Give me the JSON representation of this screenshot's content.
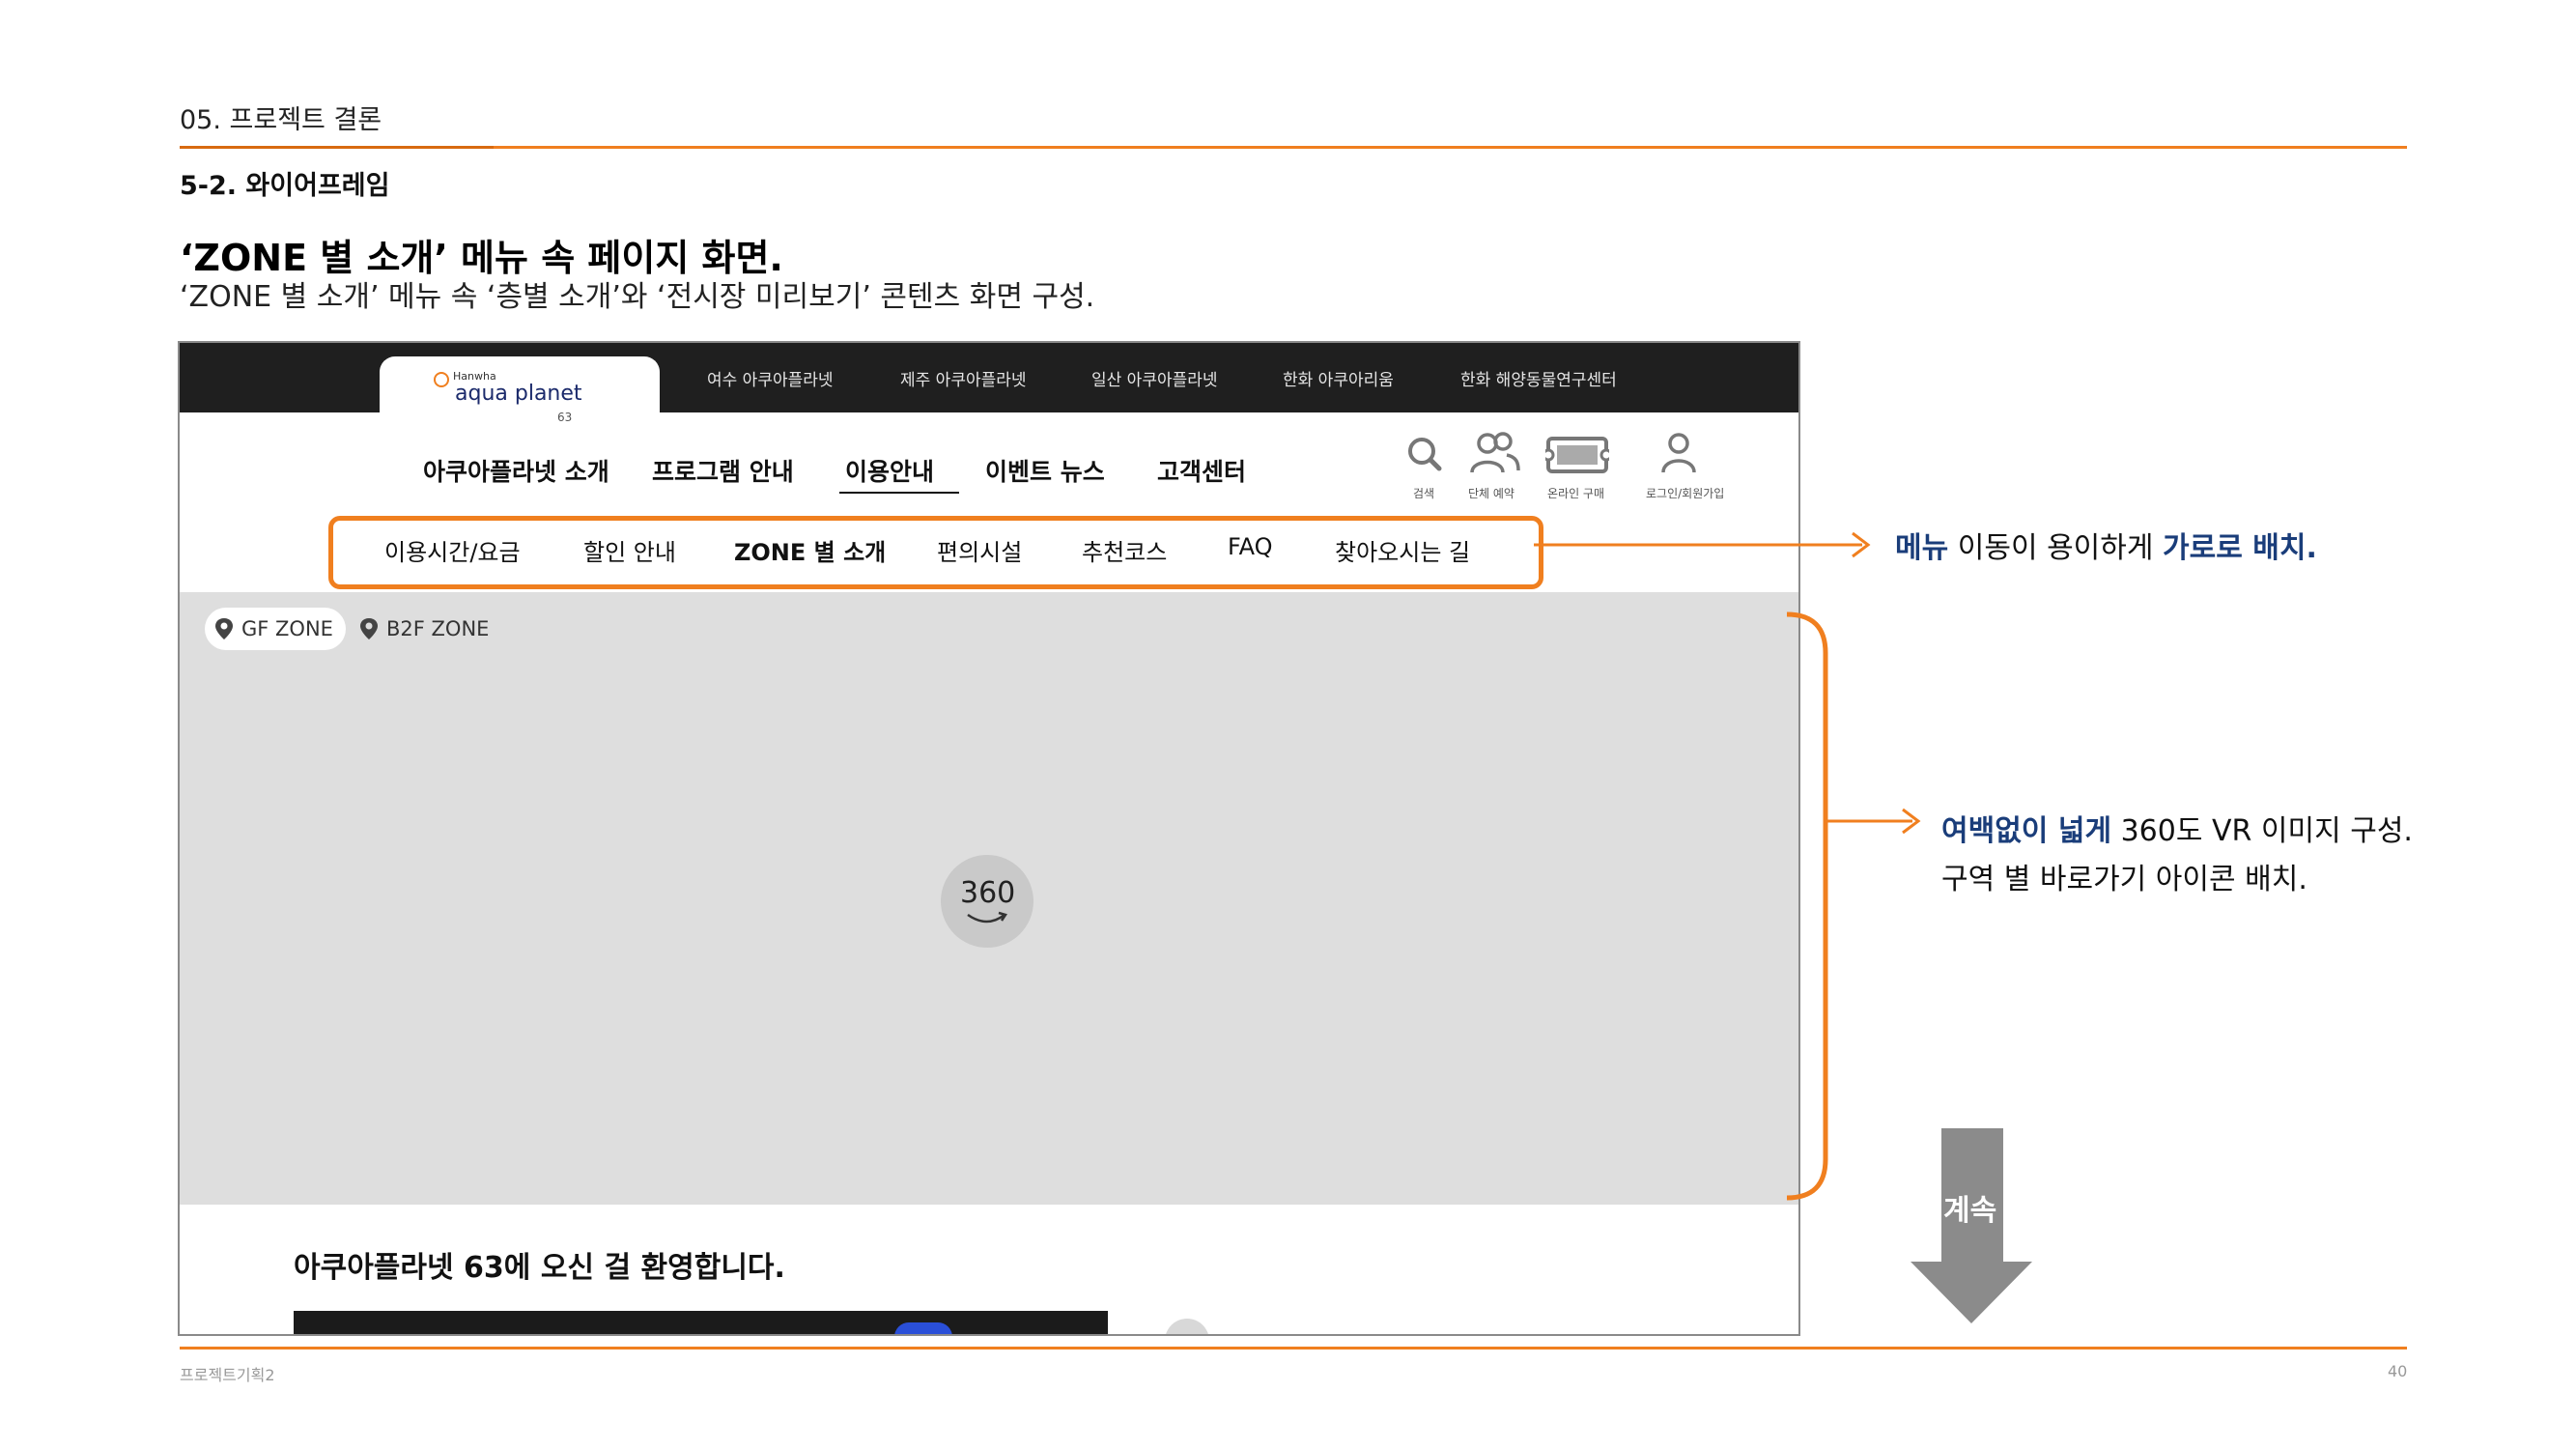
{
  "slide": {
    "section_title": "05. 프로젝트 결론",
    "sub_title": "5-2. 와이어프레임",
    "main_title": "‘ZONE 별 소개’ 메뉴 속 페이지 화면.",
    "main_desc": "‘ZONE 별 소개’ 메뉴 속 ‘층별 소개’와 ‘전시장 미리보기’ 콘텐츠 화면 구성.",
    "footer_left": "프로젝트기획2",
    "page_number": "40"
  },
  "wireframe": {
    "logo": {
      "brand": "Hanwha",
      "main": "aqua planet",
      "number": "63"
    },
    "top_links": [
      "여수 아쿠아플라넷",
      "제주 아쿠아플라넷",
      "일산 아쿠아플라넷",
      "한화 아쿠아리움",
      "한화 해양동물연구센터"
    ],
    "gnb": [
      "아쿠아플라넷 소개",
      "프로그램 안내",
      "이용안내",
      "이벤트 뉴스",
      "고객센터"
    ],
    "utils": [
      "검색",
      "단체 예약",
      "온라인 구매",
      "로그인/회원가입"
    ],
    "lnb": [
      "이용시간/요금",
      "할인 안내",
      "ZONE 별 소개",
      "편의시설",
      "추천코스",
      "FAQ",
      "찾아오시는 길"
    ],
    "zones": [
      "GF ZONE",
      "B2F ZONE"
    ],
    "vr_label": "360",
    "welcome": "아쿠아플라넷 63에 오신 걸 환영합니다."
  },
  "annotations": {
    "menu_note": {
      "hl1": "메뉴",
      "mid": " 이동이 용이하게 ",
      "hl2": "가로로 배치."
    },
    "vr_note": {
      "hl1": "여백없이 넓게",
      "rest1": " 360도 VR 이미지 구성.",
      "line2": "구역 별 바로가기 아이콘 배치."
    },
    "continue": "계속"
  },
  "colors": {
    "accent": "#f07f1f",
    "highlight": "#1a3d7a",
    "topbar": "#1f1f1f",
    "vr_bg": "#dedede"
  }
}
